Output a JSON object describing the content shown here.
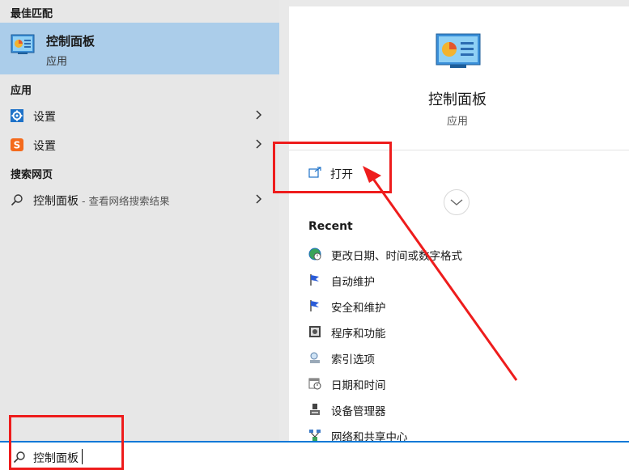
{
  "left": {
    "best_match_header": "最佳匹配",
    "best_match": {
      "title": "控制面板",
      "subtitle": "应用",
      "icon": "control-panel-icon"
    },
    "apps_header": "应用",
    "apps": [
      {
        "label": "设置",
        "icon": "gear-icon"
      },
      {
        "label": "设置",
        "icon": "sogou-s-icon"
      }
    ],
    "web_header": "搜索网页",
    "web_result": {
      "label": "控制面板",
      "sublabel": " - 查看网络搜索结果",
      "icon": "search-icon"
    }
  },
  "right": {
    "app_title": "控制面板",
    "app_type": "应用",
    "open_label": "打开",
    "recent_title": "Recent",
    "recent_items": [
      {
        "label": "更改日期、时间或数字格式",
        "icon": "globe-clock-icon"
      },
      {
        "label": "自动维护",
        "icon": "flag-icon"
      },
      {
        "label": "安全和维护",
        "icon": "flag-icon"
      },
      {
        "label": "程序和功能",
        "icon": "programs-icon"
      },
      {
        "label": "索引选项",
        "icon": "indexing-icon"
      },
      {
        "label": "日期和时间",
        "icon": "calendar-clock-icon"
      },
      {
        "label": "设备管理器",
        "icon": "device-manager-icon"
      },
      {
        "label": "网络和共享中心",
        "icon": "network-icon"
      }
    ]
  },
  "search": {
    "value": "控制面板",
    "icon": "search-icon"
  },
  "colors": {
    "selection": "#abcdea",
    "accent": "#0078d7",
    "annotation": "#ee1c1c"
  }
}
